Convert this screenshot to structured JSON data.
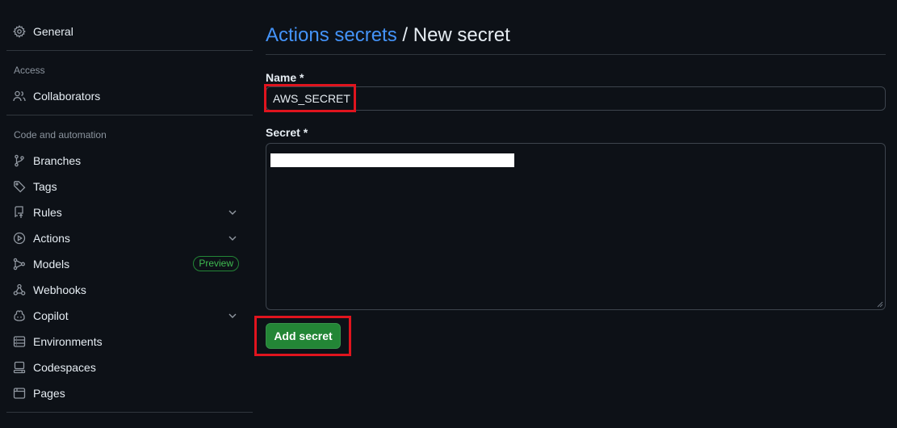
{
  "sidebar": {
    "general": {
      "label": "General",
      "icon": "gear-icon"
    },
    "sections": {
      "access": "Access",
      "code_automation": "Code and automation"
    },
    "items": [
      {
        "label": "Collaborators",
        "icon": "people-icon"
      },
      {
        "label": "Branches",
        "icon": "git-branch-icon"
      },
      {
        "label": "Tags",
        "icon": "tag-icon"
      },
      {
        "label": "Rules",
        "icon": "repo-push-icon",
        "expandable": true
      },
      {
        "label": "Actions",
        "icon": "play-icon",
        "expandable": true
      },
      {
        "label": "Models",
        "icon": "ai-model-icon",
        "badge": "Preview"
      },
      {
        "label": "Webhooks",
        "icon": "webhook-icon"
      },
      {
        "label": "Copilot",
        "icon": "copilot-icon",
        "expandable": true
      },
      {
        "label": "Environments",
        "icon": "server-icon"
      },
      {
        "label": "Codespaces",
        "icon": "codespaces-icon"
      },
      {
        "label": "Pages",
        "icon": "browser-icon"
      }
    ]
  },
  "header": {
    "breadcrumb_link": "Actions secrets",
    "separator": "/",
    "current": "New secret"
  },
  "form": {
    "name_label": "Name *",
    "name_value": "AWS_SECRET",
    "secret_label": "Secret *",
    "submit_label": "Add secret"
  },
  "colors": {
    "background": "#0d1117",
    "link": "#4493f8",
    "primary_button": "#238636",
    "badge": "#3fb950",
    "highlight": "#e0141e",
    "border": "#30363d"
  }
}
